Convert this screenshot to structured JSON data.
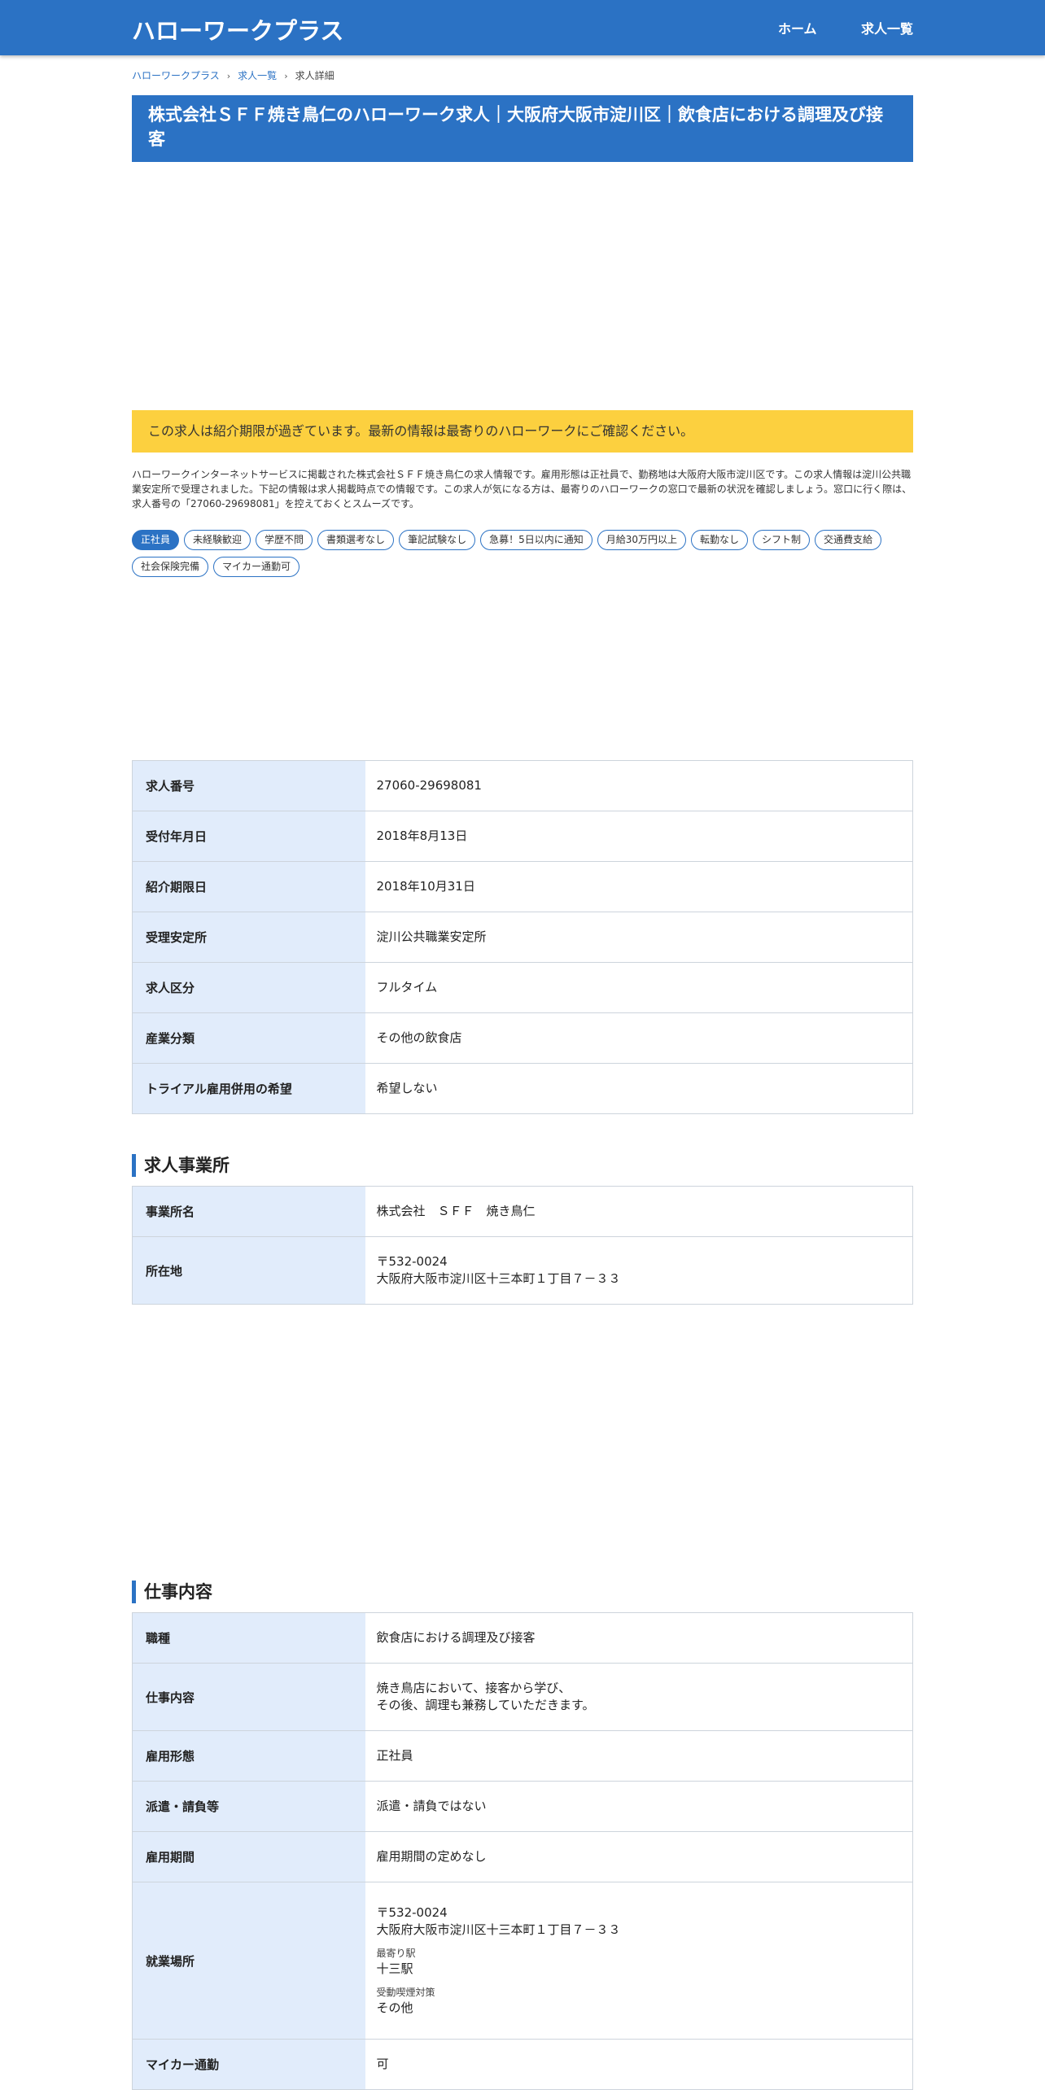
{
  "header": {
    "brand": "ハローワークプラス",
    "nav": [
      "ホーム",
      "求人一覧"
    ]
  },
  "breadcrumb": [
    "ハローワークプラス",
    "求人一覧",
    "求人詳細"
  ],
  "title": "株式会社ＳＦＦ焼き鳥仁のハローワーク求人｜大阪府大阪市淀川区｜飲食店における調理及び接客",
  "alert": "この求人は紹介期限が過ぎています。最新の情報は最寄りのハローワークにご確認ください。",
  "intro": "ハローワークインターネットサービスに掲載された株式会社ＳＦＦ焼き鳥仁の求人情報です。雇用形態は正社員で、勤務地は大阪府大阪市淀川区です。この求人情報は淀川公共職業安定所で受理されました。下記の情報は求人掲載時点での情報です。この求人が気になる方は、最寄りのハローワークの窓口で最新の状況を確認しましょう。窓口に行く際は、求人番号の「27060-29698081」を控えておくとスムーズです。",
  "tags": [
    "正社員",
    "未経験歓迎",
    "学歴不問",
    "書類選考なし",
    "筆記試験なし",
    "急募！5日以内に通知",
    "月給30万円以上",
    "転勤なし",
    "シフト制",
    "交通費支給",
    "社会保険完備",
    "マイカー通勤可"
  ],
  "basic": [
    {
      "label": "求人番号",
      "value": "27060-29698081"
    },
    {
      "label": "受付年月日",
      "value": "2018年8月13日"
    },
    {
      "label": "紹介期限日",
      "value": "2018年10月31日"
    },
    {
      "label": "受理安定所",
      "value": "淀川公共職業安定所"
    },
    {
      "label": "求人区分",
      "value": "フルタイム"
    },
    {
      "label": "産業分類",
      "value": "その他の飲食店"
    },
    {
      "label": "トライアル雇用併用の希望",
      "value": "希望しない"
    }
  ],
  "office": {
    "heading": "求人事業所",
    "name_label": "事業所名",
    "name": "株式会社　ＳＦＦ　焼き鳥仁",
    "address_label": "所在地",
    "postal": "〒532-0024",
    "address": "大阪府大阪市淀川区十三本町１丁目７－３３"
  },
  "job": {
    "heading": "仕事内容",
    "type_label": "職種",
    "type": "飲食店における調理及び接客",
    "content_label": "仕事内容",
    "content_line1": "焼き鳥店において、接客から学び、",
    "content_line2": "その後、調理も兼務していただきます。",
    "employment_label": "雇用形態",
    "employment": "正社員",
    "dispatch_label": "派遣・請負等",
    "dispatch": "派遣・請負ではない",
    "period_label": "雇用期間",
    "period": "雇用期間の定めなし",
    "place_label": "就業場所",
    "place_postal": "〒532-0024",
    "place_address": "大阪府大阪市淀川区十三本町１丁目７－３３",
    "station_label": "最寄り駅",
    "station": "十三駅",
    "smoke_label": "受動喫煙対策",
    "smoke": "その他",
    "car_label": "マイカー通勤",
    "car": "可"
  }
}
